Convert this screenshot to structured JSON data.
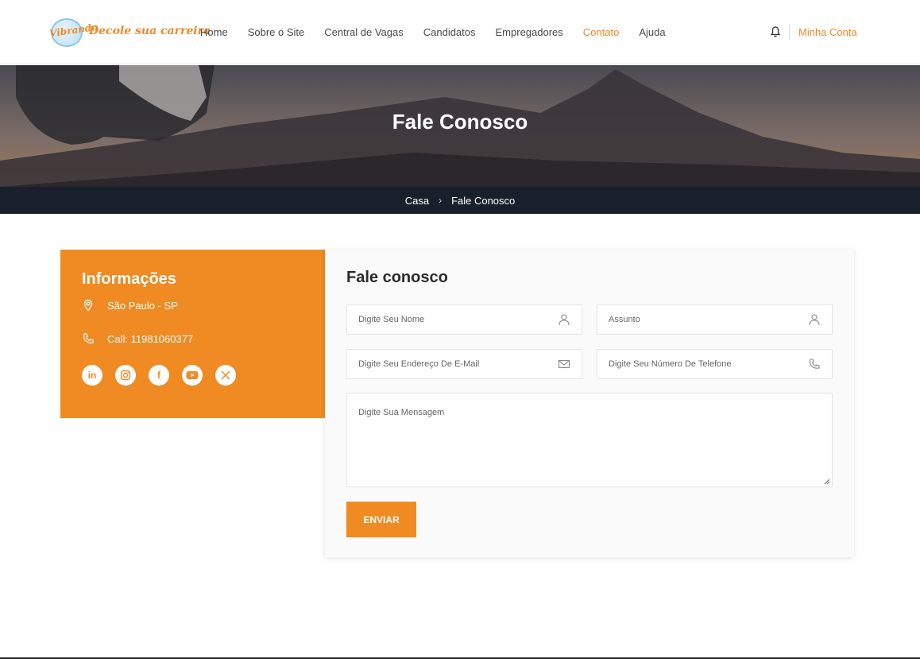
{
  "header": {
    "logo_text_1": "Vibrando",
    "logo_text_2": "Decole sua carreira",
    "nav": [
      "Home",
      "Sobre o Site",
      "Central de Vagas",
      "Candidatos",
      "Empregadores",
      "Contato",
      "Ajuda"
    ],
    "active_nav": "Contato",
    "account_label": "Minha Conta"
  },
  "hero": {
    "title": "Fale Conosco"
  },
  "breadcrumb": {
    "home": "Casa",
    "current": "Fale Conosco"
  },
  "info": {
    "title": "Informações",
    "location": "São Paulo - SP",
    "phone": "Call: 11981060377",
    "socials": [
      "linkedin-icon",
      "instagram-icon",
      "facebook-icon",
      "youtube-icon",
      "x-icon"
    ]
  },
  "form": {
    "title": "Fale conosco",
    "name_placeholder": "Digite Seu Nome",
    "subject_placeholder": "Assunto",
    "email_placeholder": "Digite Seu Endereço De E-Mail",
    "phone_placeholder": "Digite Seu Número De Telefone",
    "message_placeholder": "Digite Sua Mensagem",
    "submit_label": "ENVIAR"
  },
  "colors": {
    "accent": "#f08a22",
    "breadcrumb_bg": "#18212b"
  }
}
